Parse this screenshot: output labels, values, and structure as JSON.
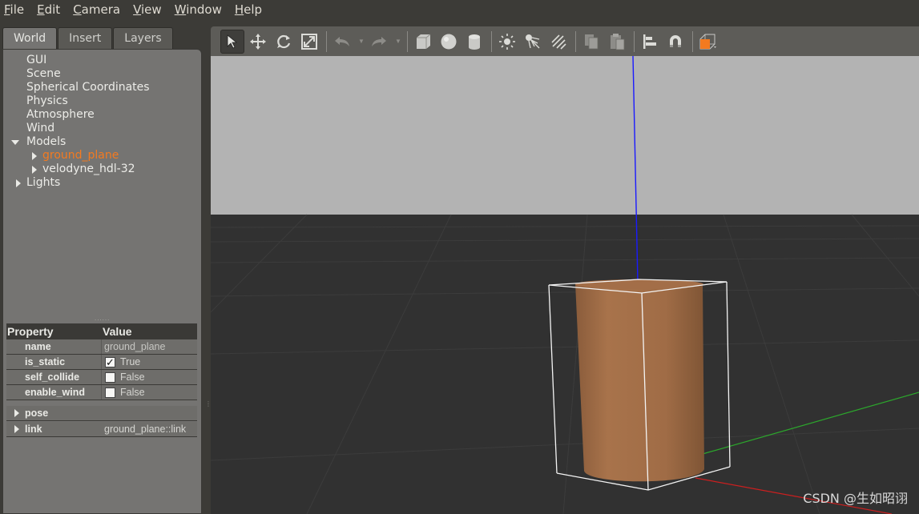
{
  "menu": [
    {
      "first": "F",
      "rest": "ile"
    },
    {
      "first": "E",
      "rest": "dit"
    },
    {
      "first": "C",
      "rest": "amera"
    },
    {
      "first": "V",
      "rest": "iew"
    },
    {
      "first": "W",
      "rest": "indow"
    },
    {
      "first": "H",
      "rest": "elp"
    }
  ],
  "tabs": [
    "World",
    "Insert",
    "Layers"
  ],
  "tree": {
    "gui": "GUI",
    "scene": "Scene",
    "spherical": "Spherical Coordinates",
    "physics": "Physics",
    "atmosphere": "Atmosphere",
    "wind": "Wind",
    "models": "Models",
    "model_ground": "ground_plane",
    "model_velodyne": "velodyne_hdl-32",
    "lights": "Lights"
  },
  "properties": {
    "header_property": "Property",
    "header_value": "Value",
    "rows": [
      {
        "name": "name",
        "value": "ground_plane"
      },
      {
        "name": "is_static",
        "value": "True",
        "checked": true
      },
      {
        "name": "self_collide",
        "value": "False",
        "checked": false
      },
      {
        "name": "enable_wind",
        "value": "False",
        "checked": false
      }
    ],
    "pose": "pose",
    "link": "link",
    "link_value": "ground_plane::link"
  },
  "toolbar_icons": [
    "select-arrow-icon",
    "translate-icon",
    "rotate-icon",
    "scale-icon",
    "undo-icon",
    "redo-icon",
    "box-icon",
    "sphere-icon",
    "cylinder-icon",
    "point-light-icon",
    "spot-light-icon",
    "directional-light-icon",
    "copy-icon",
    "paste-icon",
    "align-icon",
    "snap-icon",
    "view-angle-icon"
  ],
  "colors": {
    "selection_orange": "#f37a20",
    "cylinder": "#a36e48",
    "sky": "#b3b3b3",
    "ground": "#313131",
    "z_axis": "#1a1aff",
    "y_axis": "#2ca82c",
    "x_axis": "#cc1f1f"
  },
  "watermark": "CSDN @生如昭诩"
}
